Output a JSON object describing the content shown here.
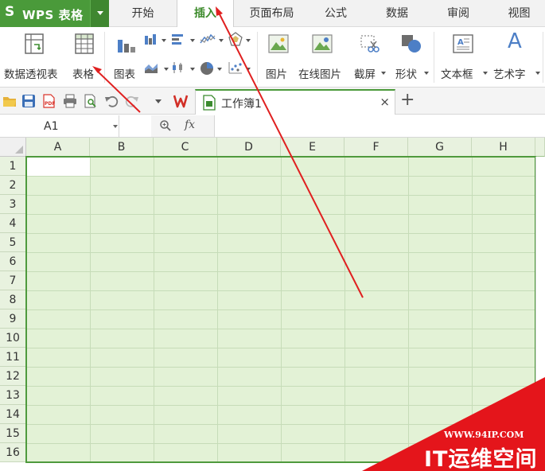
{
  "app": {
    "logo": "S",
    "title": "WPS 表格"
  },
  "menu": {
    "tabs": [
      {
        "label": "开始"
      },
      {
        "label": "插入"
      },
      {
        "label": "页面布局"
      },
      {
        "label": "公式"
      },
      {
        "label": "数据"
      },
      {
        "label": "审阅"
      },
      {
        "label": "视图"
      }
    ],
    "active_tab": "插入"
  },
  "ribbon": {
    "pivot_table": "数据透视表",
    "table": "表格",
    "chart": "图表",
    "picture": "图片",
    "online_picture": "在线图片",
    "screenshot": "截屏",
    "shapes": "形状",
    "textbox": "文本框",
    "wordart": "艺术字",
    "wordart_glyph": "A"
  },
  "document": {
    "name": "工作簿1",
    "close_glyph": "×",
    "new_tab_glyph": "+"
  },
  "formula_bar": {
    "name_box": "A1",
    "fx_label": "fx",
    "formula_value": ""
  },
  "grid": {
    "columns": [
      "A",
      "B",
      "C",
      "D",
      "E",
      "F",
      "G",
      "H"
    ],
    "rows": [
      "1",
      "2",
      "3",
      "4",
      "5",
      "6",
      "7",
      "8",
      "9",
      "10",
      "11",
      "12",
      "13",
      "14",
      "15",
      "16"
    ],
    "active_cell": "A1"
  },
  "watermark": {
    "url": "WWW.94IP.COM",
    "brand": "IT运维空间"
  },
  "colors": {
    "brand_green": "#4a9a3a",
    "active_tab_text": "#3d8b2c",
    "selection_fill": "#e3f2d6",
    "selection_border": "#4f9a3d",
    "annotation_arrow": "#e02020",
    "watermark_red": "#e4151b"
  }
}
